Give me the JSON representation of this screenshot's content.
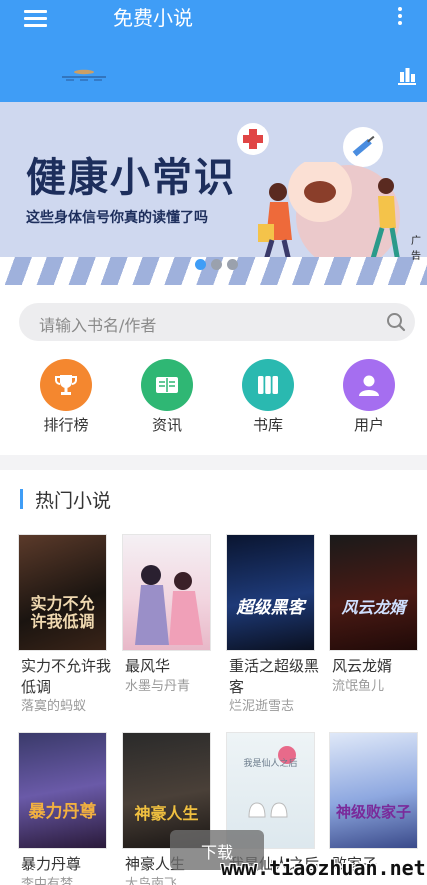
{
  "app": {
    "title": "免费小说"
  },
  "header": {
    "menu_icon": "hamburger-menu-icon",
    "more_icon": "more-vertical-icon",
    "rank_icon": "ranking-chart-icon"
  },
  "banner": {
    "headline": "健康小常识",
    "subtitle": "这些身体信号你真的读懂了吗",
    "ad_mark": "广告",
    "active_slide": 0,
    "slide_count": 3
  },
  "search": {
    "placeholder": "请输入书名/作者"
  },
  "quick_nav": [
    {
      "label": "排行榜",
      "icon": "trophy-icon",
      "color": "#f4872f"
    },
    {
      "label": "资讯",
      "icon": "open-book-icon",
      "color": "#2fb774"
    },
    {
      "label": "书库",
      "icon": "bookshelf-icon",
      "color": "#2ab9b0"
    },
    {
      "label": "用户",
      "icon": "user-icon",
      "color": "#a56ef0"
    }
  ],
  "hot_section": {
    "title": "热门小说"
  },
  "books": [
    {
      "name": "实力不允许我低调",
      "author": "落寞的蚂蚁",
      "cover_title": "实力不允许我低调"
    },
    {
      "name": "最风华",
      "author": "水墨与丹青",
      "cover_title": ""
    },
    {
      "name": "重活之超级黑客",
      "author": "烂泥逝雪志",
      "cover_title": "超级黑客"
    },
    {
      "name": "风云龙婿",
      "author": "流氓鱼儿",
      "cover_title": "风云龙婿"
    },
    {
      "name": "暴力丹尊",
      "author": "李中有梦",
      "cover_title": "暴力丹尊"
    },
    {
      "name": "神豪人生",
      "author": "大鸟南飞",
      "cover_title": "神豪人生"
    },
    {
      "name": "我是仙人之后",
      "author": "",
      "cover_title": "我是仙人之后"
    },
    {
      "name": "败家子",
      "author": "",
      "cover_title": "神级败家子"
    }
  ],
  "download": {
    "label": "下载"
  },
  "watermark": {
    "text": "www.tiaozhuan.net"
  }
}
